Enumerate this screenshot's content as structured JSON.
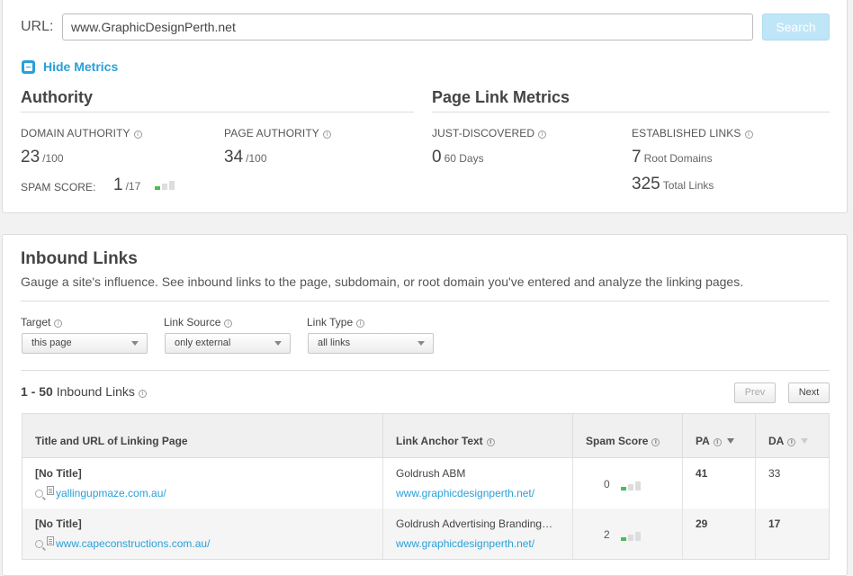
{
  "search": {
    "url_label": "URL:",
    "url_value": "www.GraphicDesignPerth.net",
    "button_label": "Search"
  },
  "metrics_toggle": {
    "label": "Hide Metrics"
  },
  "authority": {
    "title": "Authority",
    "domain_authority": {
      "label": "DOMAIN AUTHORITY",
      "value": "23",
      "unit": "/100"
    },
    "page_authority": {
      "label": "PAGE AUTHORITY",
      "value": "34",
      "unit": "/100"
    },
    "spam_score": {
      "label": "SPAM SCORE:",
      "value": "1",
      "unit": "/17",
      "level": 1,
      "max_level": 3
    }
  },
  "page_link_metrics": {
    "title": "Page Link Metrics",
    "just_discovered": {
      "label": "JUST-DISCOVERED",
      "value": "0",
      "unit": "60 Days"
    },
    "established_links": {
      "label": "ESTABLISHED LINKS",
      "root_domains_value": "7",
      "root_domains_unit": "Root Domains",
      "total_links_value": "325",
      "total_links_unit": "Total Links"
    }
  },
  "inbound": {
    "title": "Inbound Links",
    "description": "Gauge a site's influence. See inbound links to the page, subdomain, or root domain you've entered and analyze the linking pages.",
    "filters": {
      "target": {
        "label": "Target",
        "selected": "this page"
      },
      "link_source": {
        "label": "Link Source",
        "selected": "only external"
      },
      "link_type": {
        "label": "Link Type",
        "selected": "all links"
      }
    },
    "count_range": "1 - 50",
    "count_label": "Inbound Links",
    "prev_label": "Prev",
    "next_label": "Next",
    "columns": {
      "title_url": "Title and URL of Linking Page",
      "anchor": "Link Anchor Text",
      "spam": "Spam Score",
      "pa": "PA",
      "da": "DA"
    },
    "rows": [
      {
        "title": "[No Title]",
        "url": "yallingupmaze.com.au/",
        "anchor_text": "Goldrush ABM",
        "anchor_url": "www.graphicdesignperth.net/",
        "spam_score": "0",
        "spam_level": 1,
        "pa": "41",
        "da": "33"
      },
      {
        "title": "[No Title]",
        "url": "www.capeconstructions.com.au/",
        "anchor_text": "Goldrush Advertising Branding…",
        "anchor_url": "www.graphicdesignperth.net/",
        "spam_score": "2",
        "spam_level": 1,
        "pa": "29",
        "da": "17"
      }
    ]
  }
}
